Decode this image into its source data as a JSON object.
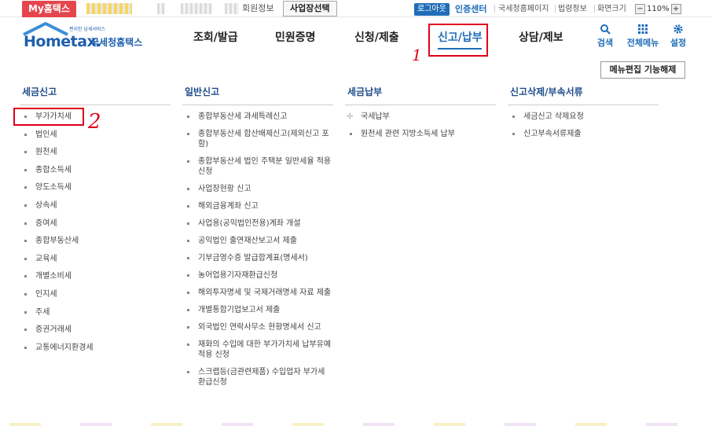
{
  "topbar": {
    "my_tab": "My홈택스",
    "member_info": "회원정보",
    "business_select": "사업장선택",
    "logout": "로그아웃",
    "cert_center": "인증센터",
    "links": [
      "국세청홈페이지",
      "법령정보",
      "화면크기"
    ],
    "zoom_level": "110%",
    "zoom_minus": "−",
    "zoom_plus": "+"
  },
  "header": {
    "logo_text": "Hometax.",
    "logo_kr": "국세청홈택스",
    "logo_small": "편리한 납세서비스",
    "gnb": [
      "조회/발급",
      "민원증명",
      "신청/제출",
      "신고/납부",
      "상담/제보"
    ],
    "icons": [
      {
        "label": "검색",
        "icon": "search-icon"
      },
      {
        "label": "전체메뉴",
        "icon": "grid-icon"
      },
      {
        "label": "설정",
        "icon": "gear-icon"
      }
    ],
    "menu_edit_button": "메뉴편집 기능해제"
  },
  "annotations": {
    "mark1": "1",
    "mark2": "2"
  },
  "menu": {
    "col1": {
      "title": "세금신고",
      "items": [
        "부가가치세",
        "법인세",
        "원천세",
        "종합소득세",
        "양도소득세",
        "상속세",
        "증여세",
        "종합부동산세",
        "교육세",
        "개별소비세",
        "인지세",
        "주세",
        "증권거래세",
        "교통에너지환경세"
      ]
    },
    "col2": {
      "title": "일반신고",
      "items": [
        "종합부동산세 과세특례신고",
        "종합부동산세 합산배제신고(제외신고 포함)",
        "종합부동산세 법인 주택분 일반세율 적용 신청",
        "사업장현황 신고",
        "해외금융계좌 신고",
        "사업용(공익법인전용)계좌 개설",
        "공익법인 출연재산보고서 제출",
        "기부금영수증 발급합계표(명세서)",
        "농어업용기자재환급신청",
        "해외투자명세 및 국제거래명세 자료 제출",
        "개별통합기업보고서 제출",
        "외국법인 연락사무소 현황명세서 신고",
        "재화의 수입에 대한 부가가치세 납부유예 적용 신청",
        "스크랩등(금관련제품) 수입업자 부가세 환급신청"
      ]
    },
    "col3": {
      "title": "세금납부",
      "items": [
        "국세납부",
        "원천세 관련 지방소득세 납부"
      ]
    },
    "col4": {
      "title": "신고삭제/부속서류",
      "items": [
        "세금신고 삭제요청",
        "신고부속서류제출"
      ]
    }
  }
}
